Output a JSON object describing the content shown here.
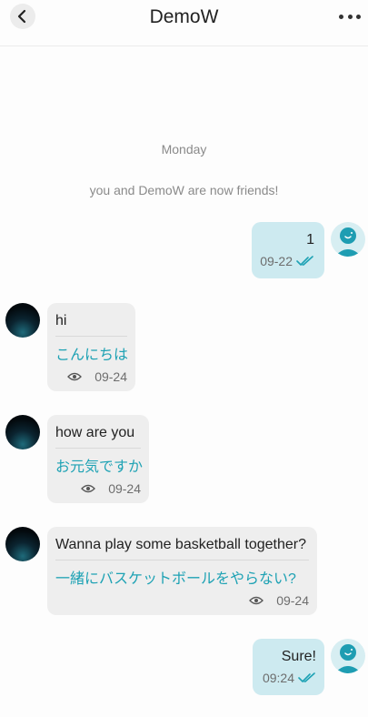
{
  "header": {
    "title": "DemoW",
    "back_icon": "chevron-left-icon",
    "more_icon": "more-horizontal-icon"
  },
  "system": {
    "day": "Monday",
    "notice": "you and DemoW are now friends!"
  },
  "colors": {
    "accent": "#1ea2b4",
    "outgoing_bubble": "#cdeaf0",
    "incoming_bubble": "#eeeeee"
  },
  "messages": [
    {
      "direction": "outgoing",
      "text": "1",
      "time": "09-22",
      "status_icon": "double-check-icon"
    },
    {
      "direction": "incoming",
      "text": "hi",
      "translation": "こんにちは",
      "time": "09-24",
      "status_icon": "eye-icon"
    },
    {
      "direction": "incoming",
      "text": "how are you",
      "translation": "お元気ですか",
      "time": "09-24",
      "status_icon": "eye-icon"
    },
    {
      "direction": "incoming",
      "text": "Wanna play some basketball together?",
      "translation": "一緒にバスケットボールをやらない?",
      "time": "09-24",
      "status_icon": "eye-icon"
    },
    {
      "direction": "outgoing",
      "text": "Sure!",
      "time": "09:24",
      "status_icon": "double-check-icon"
    }
  ]
}
